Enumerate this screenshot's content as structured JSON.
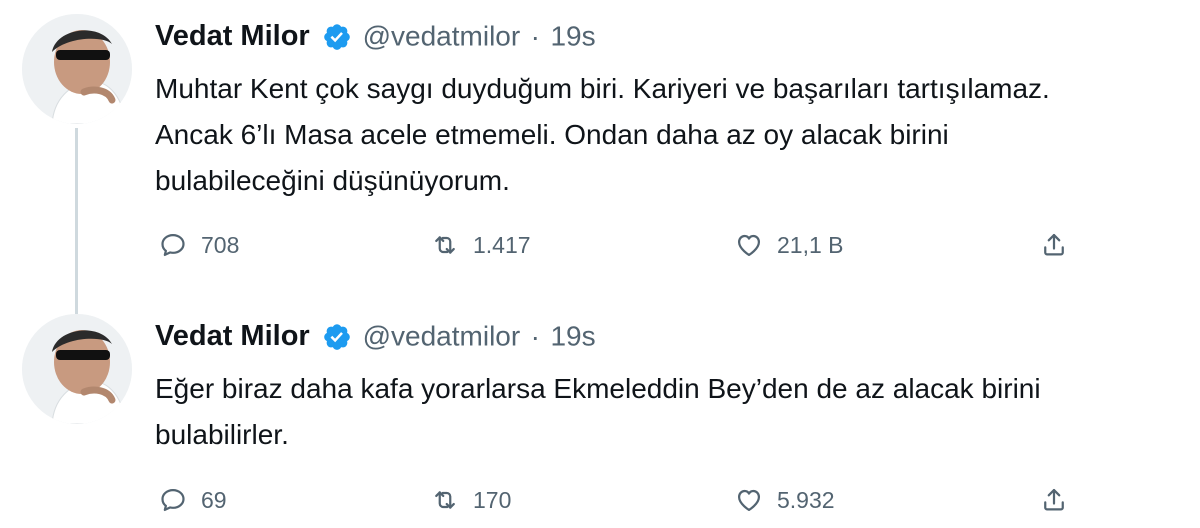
{
  "tweets": [
    {
      "author": {
        "name": "Vedat Milor",
        "handle": "@vedatmilor",
        "verified": true
      },
      "separator": "·",
      "time": "19s",
      "text_lines": [
        "Muhtar Kent çok saygı duyduğum biri. Kariyeri ve başarıları tartışılamaz.",
        "Ancak 6’lı Masa acele etmemeli. Ondan daha az oy alacak birini",
        "bulabileceğini düşünüyorum."
      ],
      "stats": {
        "replies": "708",
        "retweets": "1.417",
        "likes": "21,1 B"
      },
      "icons": {
        "reply": "reply-icon",
        "retweet": "retweet-icon",
        "like": "like-icon",
        "share": "share-icon"
      }
    },
    {
      "author": {
        "name": "Vedat Milor",
        "handle": "@vedatmilor",
        "verified": true
      },
      "separator": "·",
      "time": "19s",
      "text_lines": [
        "Eğer biraz daha kafa yorarlarsa Ekmeleddin Bey’den de az alacak birini",
        "bulabilirler."
      ],
      "stats": {
        "replies": "69",
        "retweets": "170",
        "likes": "5.932"
      },
      "icons": {
        "reply": "reply-icon",
        "retweet": "retweet-icon",
        "like": "like-icon",
        "share": "share-icon"
      }
    }
  ],
  "colors": {
    "text": "#0f1419",
    "secondary": "#536471",
    "verified_badge": "#1d9bf0",
    "thread_line": "#cfd9de"
  }
}
